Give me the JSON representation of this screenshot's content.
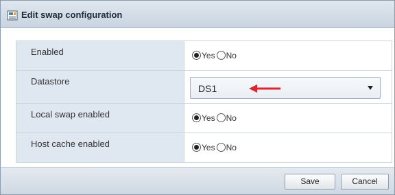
{
  "dialog": {
    "title": "Edit swap configuration",
    "title_icon": "swap-config-icon"
  },
  "rows": [
    {
      "label": "Enabled",
      "control": "radio",
      "options": [
        "Yes",
        "No"
      ],
      "selected": "Yes"
    },
    {
      "label": "Datastore",
      "control": "select",
      "value": "DS1",
      "annotation": "red-arrow-icon"
    },
    {
      "label": "Local swap enabled",
      "control": "radio",
      "options": [
        "Yes",
        "No"
      ],
      "selected": "Yes"
    },
    {
      "label": "Host cache enabled",
      "control": "radio",
      "options": [
        "Yes",
        "No"
      ],
      "selected": "Yes"
    }
  ],
  "footer": {
    "save_label": "Save",
    "cancel_label": "Cancel"
  },
  "colors": {
    "titlebar": "#c9d4e0",
    "label_cell": "#dfe8f1",
    "annotation_arrow": "#d9272e"
  }
}
